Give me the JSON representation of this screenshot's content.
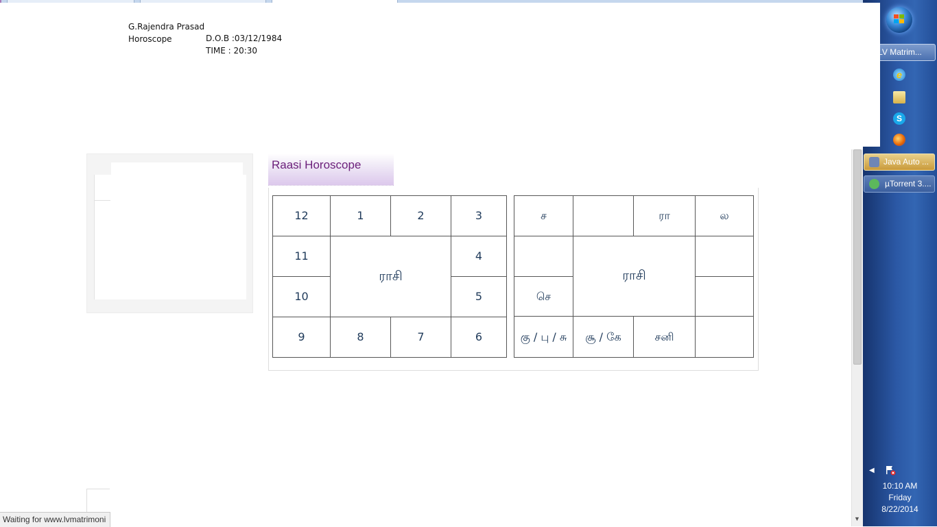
{
  "print_header": {
    "name": "G.Rajendra Prasad",
    "label": "Horoscope",
    "dob": "D.O.B :03/12/1984",
    "time": "TIME : 20:30"
  },
  "raasi_section": {
    "title": "Raasi Horoscope"
  },
  "chart_left": {
    "cells": [
      "12",
      "1",
      "2",
      "3",
      "11",
      "4",
      "10",
      "5",
      "9",
      "8",
      "7",
      "6"
    ],
    "center": "ராசி"
  },
  "chart_right": {
    "cells": [
      "ச",
      "",
      "ரா",
      "ல",
      "",
      "",
      "செ",
      "",
      "கு / பு / சு",
      "சூ / கே",
      "சனி",
      ""
    ],
    "center": "ராசி"
  },
  "status_bar": {
    "text": "Waiting for www.lvmatrimoni"
  },
  "taskbar": {
    "buttons": [
      {
        "label": "LV Matrim..."
      },
      {
        "label": "Java Auto ..."
      },
      {
        "label": "µTorrent 3...."
      }
    ],
    "quick_launch": [
      "internet-explorer-icon",
      "folder-icon",
      "skype-icon",
      "firefox-icon"
    ],
    "clock": {
      "time": "10:10 AM",
      "day": "Friday",
      "date": "8/22/2014"
    }
  },
  "colors": {
    "title_purple": "#6b1f7a",
    "cell_text": "#1f3a5a",
    "taskbar_blue": "#2b58a5"
  }
}
